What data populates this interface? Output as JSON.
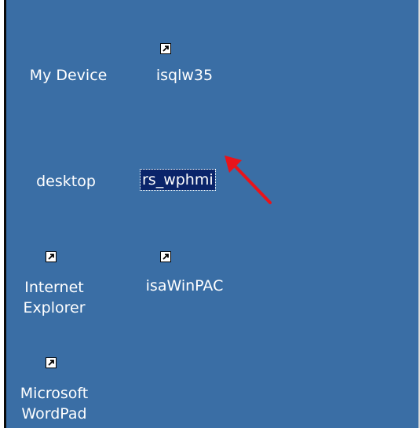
{
  "desktop": {
    "background_color": "#3A6EA5",
    "selection_color": "#0a246a",
    "icons": [
      {
        "label": "My Device",
        "icon": "handheld-device-icon",
        "shortcut": false,
        "selected": false
      },
      {
        "label": "isqlw35",
        "icon": "sql-query-icon",
        "shortcut": true,
        "selected": false
      },
      {
        "label": "desktop",
        "icon": "document-icon",
        "shortcut": false,
        "selected": false
      },
      {
        "label": "rs_wphmi",
        "icon": "application-window-icon",
        "shortcut": false,
        "selected": true
      },
      {
        "label_line1": "Internet",
        "label_line2": "Explorer",
        "icon": "internet-explorer-icon",
        "shortcut": true,
        "selected": false
      },
      {
        "label": "isaWinPAC",
        "icon": "isawinpac-icon",
        "shortcut": true,
        "selected": false
      },
      {
        "label_line1": "Microsoft",
        "label_line2": "WordPad",
        "icon": "wordpad-icon",
        "shortcut": true,
        "selected": false
      }
    ]
  },
  "annotation": {
    "arrow_color": "#e8141b"
  }
}
